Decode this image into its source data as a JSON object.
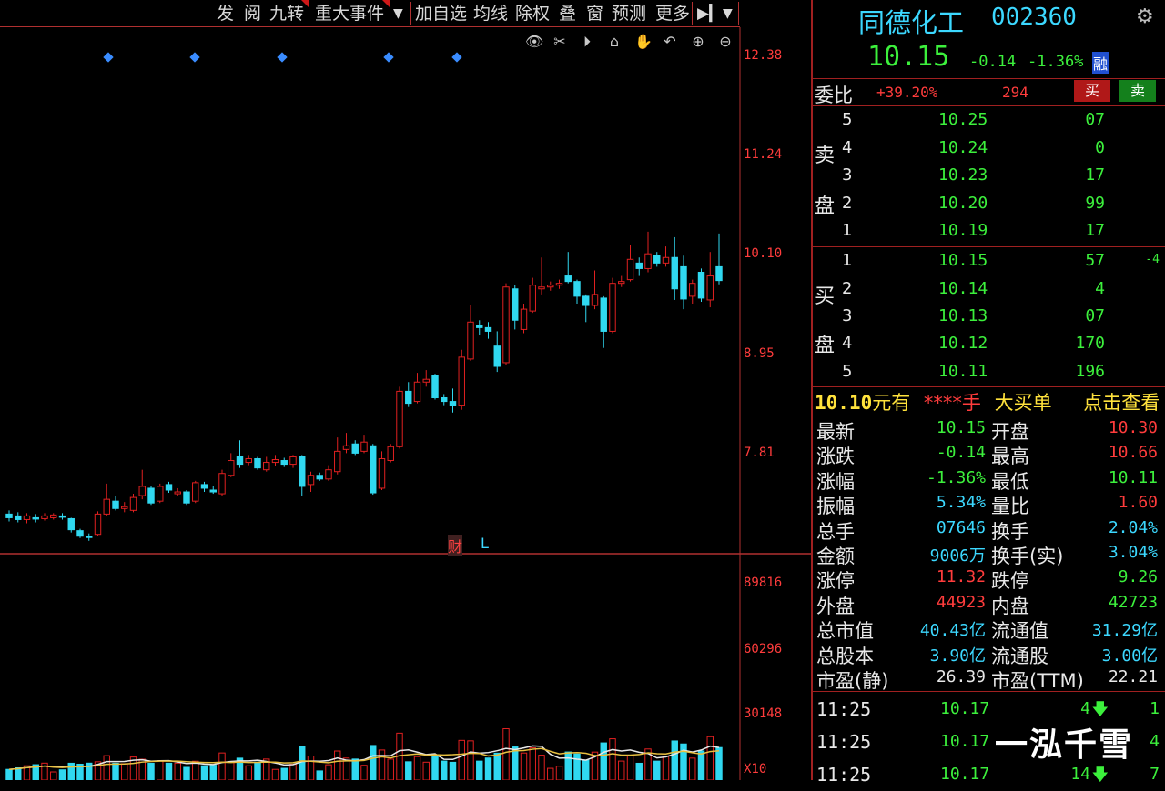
{
  "toolbar": {
    "items": [
      "发",
      "阅",
      "九转",
      "重大事件",
      "加自选",
      "均线",
      "除权",
      "叠",
      "窗",
      "预测",
      "更多"
    ],
    "dropdown_icon": "caret-down-icon",
    "exit_icon": "exit-to-right-icon"
  },
  "chart_tools": [
    "eye-icon",
    "scissors-icon",
    "play-icon",
    "lock-icon",
    "hand-icon",
    "undo-icon",
    "zoom-in-icon",
    "zoom-out-icon"
  ],
  "price_axis": [
    "12.38",
    "11.24",
    "10.10",
    "8.95",
    "7.81"
  ],
  "volume_axis": [
    "89816",
    "60296",
    "30148",
    "X10"
  ],
  "markers": {
    "cai": "财",
    "l": "L"
  },
  "chart_data": {
    "type": "candlestick",
    "ylim": [
      7.2,
      12.6
    ],
    "candles": [
      {
        "o": 7.62,
        "c": 7.58,
        "h": 7.66,
        "l": 7.54
      },
      {
        "o": 7.6,
        "c": 7.56,
        "h": 7.64,
        "l": 7.53
      },
      {
        "o": 7.56,
        "c": 7.6,
        "h": 7.63,
        "l": 7.52
      },
      {
        "o": 7.58,
        "c": 7.57,
        "h": 7.62,
        "l": 7.53
      },
      {
        "o": 7.57,
        "c": 7.6,
        "h": 7.63,
        "l": 7.55
      },
      {
        "o": 7.58,
        "c": 7.61,
        "h": 7.63,
        "l": 7.56
      },
      {
        "o": 7.6,
        "c": 7.59,
        "h": 7.63,
        "l": 7.56
      },
      {
        "o": 7.57,
        "c": 7.45,
        "h": 7.58,
        "l": 7.42
      },
      {
        "o": 7.44,
        "c": 7.38,
        "h": 7.46,
        "l": 7.36
      },
      {
        "o": 7.38,
        "c": 7.37,
        "h": 7.41,
        "l": 7.33
      },
      {
        "o": 7.4,
        "c": 7.62,
        "h": 7.65,
        "l": 7.38
      },
      {
        "o": 7.62,
        "c": 7.78,
        "h": 7.95,
        "l": 7.6
      },
      {
        "o": 7.76,
        "c": 7.68,
        "h": 7.82,
        "l": 7.66
      },
      {
        "o": 7.68,
        "c": 7.7,
        "h": 7.75,
        "l": 7.64
      },
      {
        "o": 7.66,
        "c": 7.8,
        "h": 7.84,
        "l": 7.64
      },
      {
        "o": 7.82,
        "c": 7.92,
        "h": 8.1,
        "l": 7.78
      },
      {
        "o": 7.9,
        "c": 7.74,
        "h": 7.92,
        "l": 7.72
      },
      {
        "o": 7.76,
        "c": 7.92,
        "h": 7.95,
        "l": 7.74
      },
      {
        "o": 7.94,
        "c": 7.88,
        "h": 7.97,
        "l": 7.85
      },
      {
        "o": 7.84,
        "c": 7.86,
        "h": 7.9,
        "l": 7.82
      },
      {
        "o": 7.86,
        "c": 7.74,
        "h": 7.88,
        "l": 7.72
      },
      {
        "o": 7.76,
        "c": 7.96,
        "h": 7.98,
        "l": 7.74
      },
      {
        "o": 7.94,
        "c": 7.9,
        "h": 7.97,
        "l": 7.86
      },
      {
        "o": 7.88,
        "c": 7.86,
        "h": 7.92,
        "l": 7.84
      },
      {
        "o": 7.84,
        "c": 8.06,
        "h": 8.1,
        "l": 7.82
      },
      {
        "o": 8.04,
        "c": 8.2,
        "h": 8.28,
        "l": 8.02
      },
      {
        "o": 8.24,
        "c": 8.16,
        "h": 8.42,
        "l": 8.12
      },
      {
        "o": 8.18,
        "c": 8.22,
        "h": 8.26,
        "l": 8.15
      },
      {
        "o": 8.22,
        "c": 8.12,
        "h": 8.24,
        "l": 8.1
      },
      {
        "o": 8.1,
        "c": 8.18,
        "h": 8.24,
        "l": 8.08
      },
      {
        "o": 8.18,
        "c": 8.21,
        "h": 8.26,
        "l": 8.14
      },
      {
        "o": 8.2,
        "c": 8.16,
        "h": 8.23,
        "l": 8.13
      },
      {
        "o": 8.16,
        "c": 8.24,
        "h": 8.26,
        "l": 8.12
      },
      {
        "o": 8.24,
        "c": 7.92,
        "h": 8.26,
        "l": 7.82
      },
      {
        "o": 7.94,
        "c": 8.04,
        "h": 8.08,
        "l": 7.86
      },
      {
        "o": 8.04,
        "c": 8.0,
        "h": 8.07,
        "l": 7.98
      },
      {
        "o": 8.0,
        "c": 8.1,
        "h": 8.15,
        "l": 7.98
      },
      {
        "o": 8.08,
        "c": 8.3,
        "h": 8.45,
        "l": 8.05
      },
      {
        "o": 8.32,
        "c": 8.36,
        "h": 8.5,
        "l": 8.28
      },
      {
        "o": 8.38,
        "c": 8.28,
        "h": 8.42,
        "l": 8.26
      },
      {
        "o": 8.3,
        "c": 8.4,
        "h": 8.48,
        "l": 8.28
      },
      {
        "o": 8.36,
        "c": 7.85,
        "h": 8.38,
        "l": 7.83
      },
      {
        "o": 7.9,
        "c": 8.22,
        "h": 8.3,
        "l": 7.88
      },
      {
        "o": 8.2,
        "c": 8.35,
        "h": 8.38,
        "l": 8.18
      },
      {
        "o": 8.35,
        "c": 8.95,
        "h": 9.0,
        "l": 8.33
      },
      {
        "o": 8.95,
        "c": 8.82,
        "h": 9.05,
        "l": 8.78
      },
      {
        "o": 8.84,
        "c": 9.05,
        "h": 9.15,
        "l": 8.82
      },
      {
        "o": 9.05,
        "c": 9.08,
        "h": 9.18,
        "l": 9.0
      },
      {
        "o": 9.12,
        "c": 8.88,
        "h": 9.14,
        "l": 8.86
      },
      {
        "o": 8.88,
        "c": 8.84,
        "h": 8.92,
        "l": 8.8
      },
      {
        "o": 8.84,
        "c": 8.8,
        "h": 8.98,
        "l": 8.72
      },
      {
        "o": 8.8,
        "c": 9.32,
        "h": 9.4,
        "l": 8.75
      },
      {
        "o": 9.3,
        "c": 9.7,
        "h": 9.88,
        "l": 9.28
      },
      {
        "o": 9.66,
        "c": 9.64,
        "h": 9.72,
        "l": 9.56
      },
      {
        "o": 9.64,
        "c": 9.6,
        "h": 9.7,
        "l": 9.52
      },
      {
        "o": 9.44,
        "c": 9.22,
        "h": 9.6,
        "l": 9.16
      },
      {
        "o": 9.26,
        "c": 10.08,
        "h": 10.12,
        "l": 9.24
      },
      {
        "o": 10.06,
        "c": 9.72,
        "h": 10.1,
        "l": 9.62
      },
      {
        "o": 9.62,
        "c": 9.84,
        "h": 9.9,
        "l": 9.58
      },
      {
        "o": 9.82,
        "c": 10.1,
        "h": 10.18,
        "l": 9.8
      },
      {
        "o": 10.06,
        "c": 10.08,
        "h": 10.4,
        "l": 10.0
      },
      {
        "o": 10.08,
        "c": 10.1,
        "h": 10.14,
        "l": 10.04
      },
      {
        "o": 10.1,
        "c": 10.12,
        "h": 10.16,
        "l": 10.06
      },
      {
        "o": 10.2,
        "c": 10.14,
        "h": 10.46,
        "l": 10.12
      },
      {
        "o": 10.14,
        "c": 9.98,
        "h": 10.16,
        "l": 9.9
      },
      {
        "o": 9.98,
        "c": 9.88,
        "h": 10.0,
        "l": 9.7
      },
      {
        "o": 9.88,
        "c": 10.0,
        "h": 10.26,
        "l": 9.84
      },
      {
        "o": 9.96,
        "c": 9.6,
        "h": 9.98,
        "l": 9.42
      },
      {
        "o": 9.6,
        "c": 10.12,
        "h": 10.18,
        "l": 9.58
      },
      {
        "o": 10.12,
        "c": 10.14,
        "h": 10.2,
        "l": 10.08
      },
      {
        "o": 10.16,
        "c": 10.38,
        "h": 10.54,
        "l": 10.14
      },
      {
        "o": 10.34,
        "c": 10.28,
        "h": 10.4,
        "l": 10.2
      },
      {
        "o": 10.28,
        "c": 10.44,
        "h": 10.68,
        "l": 10.24
      },
      {
        "o": 10.42,
        "c": 10.34,
        "h": 10.46,
        "l": 10.3
      },
      {
        "o": 10.34,
        "c": 10.4,
        "h": 10.52,
        "l": 10.3
      },
      {
        "o": 10.4,
        "c": 10.06,
        "h": 10.62,
        "l": 9.94
      },
      {
        "o": 10.3,
        "c": 9.95,
        "h": 10.42,
        "l": 9.84
      },
      {
        "o": 9.98,
        "c": 10.12,
        "h": 10.16,
        "l": 9.9
      },
      {
        "o": 10.24,
        "c": 9.96,
        "h": 10.28,
        "l": 9.92
      },
      {
        "o": 9.94,
        "c": 10.2,
        "h": 10.46,
        "l": 9.86
      },
      {
        "o": 10.3,
        "c": 10.15,
        "h": 10.66,
        "l": 10.11
      }
    ],
    "volume_ylim": [
      0,
      89816
    ]
  },
  "stock": {
    "name": "同德化工",
    "code": "002360",
    "price": "10.15",
    "change": "-0.14",
    "change_pct": "-1.36%",
    "badge": "融",
    "settings_icon": "gear-icon"
  },
  "order_book": {
    "weibi_label": "委比",
    "weibi_pct": "+39.20%",
    "weibi_diff": "294",
    "buy_btn": "买",
    "sell_btn": "卖",
    "sell_side_label": [
      "卖",
      "盘"
    ],
    "buy_side_label": [
      "买",
      "盘"
    ],
    "sells": [
      {
        "lvl": "5",
        "px": "10.25",
        "vol": "07"
      },
      {
        "lvl": "4",
        "px": "10.24",
        "vol": "0"
      },
      {
        "lvl": "3",
        "px": "10.23",
        "vol": "17"
      },
      {
        "lvl": "2",
        "px": "10.20",
        "vol": "99"
      },
      {
        "lvl": "1",
        "px": "10.19",
        "vol": "17"
      }
    ],
    "buys": [
      {
        "lvl": "1",
        "px": "10.15",
        "vol": "57",
        "chg": "-4"
      },
      {
        "lvl": "2",
        "px": "10.14",
        "vol": "4"
      },
      {
        "lvl": "3",
        "px": "10.13",
        "vol": "07"
      },
      {
        "lvl": "4",
        "px": "10.12",
        "vol": "170"
      },
      {
        "lvl": "5",
        "px": "10.11",
        "vol": "196"
      }
    ]
  },
  "big_order": {
    "price": "10.10",
    "you": "元有",
    "masked": "****",
    "unit": "手",
    "label": "大买单",
    "link": "点击查看"
  },
  "quote": [
    {
      "l1": "最新",
      "v1": "10.15",
      "c1": "green",
      "l2": "开盘",
      "v2": "10.30",
      "c2": "red"
    },
    {
      "l1": "涨跌",
      "v1": "-0.14",
      "c1": "green",
      "l2": "最高",
      "v2": "10.66",
      "c2": "red"
    },
    {
      "l1": "涨幅",
      "v1": "-1.36%",
      "c1": "green",
      "l2": "最低",
      "v2": "10.11",
      "c2": "green"
    },
    {
      "l1": "振幅",
      "v1": "5.34%",
      "c1": "cyan",
      "l2": "量比",
      "v2": "1.60",
      "c2": "red"
    },
    {
      "l1": "总手",
      "v1": "07646",
      "c1": "cyan",
      "l2": "换手",
      "v2": "2.04%",
      "c2": "cyan"
    },
    {
      "l1": "金额",
      "v1": "9006万",
      "c1": "cyan",
      "l2": "换手(实)",
      "v2": "3.04%",
      "c2": "cyan"
    },
    {
      "l1": "涨停",
      "v1": "11.32",
      "c1": "red",
      "l2": "跌停",
      "v2": "9.26",
      "c2": "green"
    },
    {
      "l1": "外盘",
      "v1": "44923",
      "c1": "red",
      "l2": "内盘",
      "v2": "42723",
      "c2": "green"
    },
    {
      "l1": "总市值",
      "v1": "40.43亿",
      "c1": "cyan",
      "l2": "流通值",
      "v2": "31.29亿",
      "c2": "cyan"
    },
    {
      "l1": "总股本",
      "v1": "3.90亿",
      "c1": "cyan",
      "l2": "流通股",
      "v2": "3.00亿",
      "c2": "cyan"
    },
    {
      "l1": "市盈(静)",
      "v1": "26.39",
      "c1": "white",
      "l2": "市盈(TTM)",
      "v2": "22.21",
      "c2": "white"
    }
  ],
  "ticks": [
    {
      "t": "11:25",
      "p": "10.17",
      "v": "4",
      "n": "1"
    },
    {
      "t": "11:25",
      "p": "10.17",
      "v": "",
      "n": "4"
    },
    {
      "t": "11:25",
      "p": "10.17",
      "v": "14",
      "n": "7"
    }
  ],
  "watermark": "一泓千雪",
  "colors": {
    "up": "#e02020",
    "down": "#30d8f0",
    "panel_line": "#a02020"
  }
}
